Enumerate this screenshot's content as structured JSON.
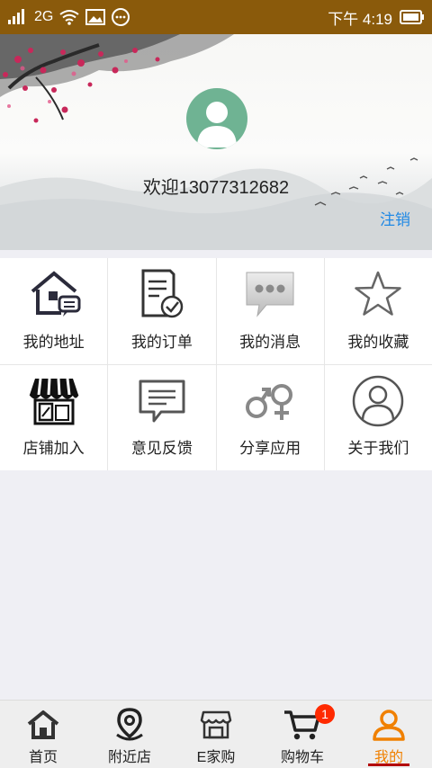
{
  "status_bar": {
    "network": "2G",
    "time": "下午 4:19"
  },
  "profile": {
    "welcome": "欢迎13077312682",
    "logout": "注销"
  },
  "menu": [
    {
      "label": "我的地址",
      "icon": "house-address-icon"
    },
    {
      "label": "我的订单",
      "icon": "order-document-icon"
    },
    {
      "label": "我的消息",
      "icon": "message-bubble-icon"
    },
    {
      "label": "我的收藏",
      "icon": "star-icon"
    },
    {
      "label": "店铺加入",
      "icon": "storefront-icon"
    },
    {
      "label": "意见反馈",
      "icon": "feedback-icon"
    },
    {
      "label": "分享应用",
      "icon": "share-gender-icon"
    },
    {
      "label": "关于我们",
      "icon": "about-person-icon"
    }
  ],
  "nav": {
    "home": "首页",
    "nearby": "附近店",
    "ehome": "E家购",
    "cart": "购物车",
    "cart_badge": "1",
    "mine": "我的",
    "active_color": "#f08000"
  },
  "colors": {
    "status_bar": "#8a5a0b",
    "avatar": "#6fb393",
    "link": "#1e88e5"
  }
}
